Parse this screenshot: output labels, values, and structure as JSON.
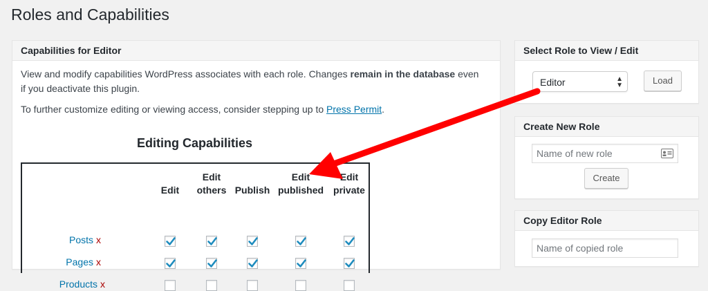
{
  "page": {
    "title": "Roles and Capabilities"
  },
  "main": {
    "header": "Capabilities for Editor",
    "intro_line1_a": "View and modify capabilities WordPress associates with each role. Changes ",
    "intro_line1_bold": "remain in the database",
    "intro_line1_b": " even",
    "intro_line2": "if you deactivate this plugin.",
    "intro_line3_a": "To further customize editing or viewing access, consider stepping up to ",
    "intro_link": "Press Permit",
    "intro_line3_b": ".",
    "capabilities_title": "Editing Capabilities",
    "columns": [
      {
        "line1": "Edit",
        "line2": ""
      },
      {
        "line1": "Edit",
        "line2": "others"
      },
      {
        "line1": "Publish",
        "line2": ""
      },
      {
        "line1": "Edit",
        "line2": "published"
      },
      {
        "line1": "Edit",
        "line2": "private"
      }
    ],
    "rows": [
      {
        "label": "Posts",
        "remove": "x",
        "checks": [
          true,
          true,
          true,
          true,
          true
        ]
      },
      {
        "label": "Pages",
        "remove": "x",
        "checks": [
          true,
          true,
          true,
          true,
          true
        ]
      },
      {
        "label": "Products",
        "remove": "x",
        "checks": [
          false,
          false,
          false,
          false,
          false
        ]
      }
    ]
  },
  "select_role": {
    "header": "Select Role to View / Edit",
    "selected": "Editor",
    "load_label": "Load"
  },
  "create_role": {
    "header": "Create New Role",
    "placeholder": "Name of new role",
    "button_label": "Create"
  },
  "copy_role": {
    "header": "Copy Editor Role",
    "placeholder": "Name of copied role"
  },
  "colors": {
    "link": "#0073aa",
    "remove": "#aa0000",
    "check": "#1e8cbe",
    "annotation_arrow": "#ff0000"
  }
}
